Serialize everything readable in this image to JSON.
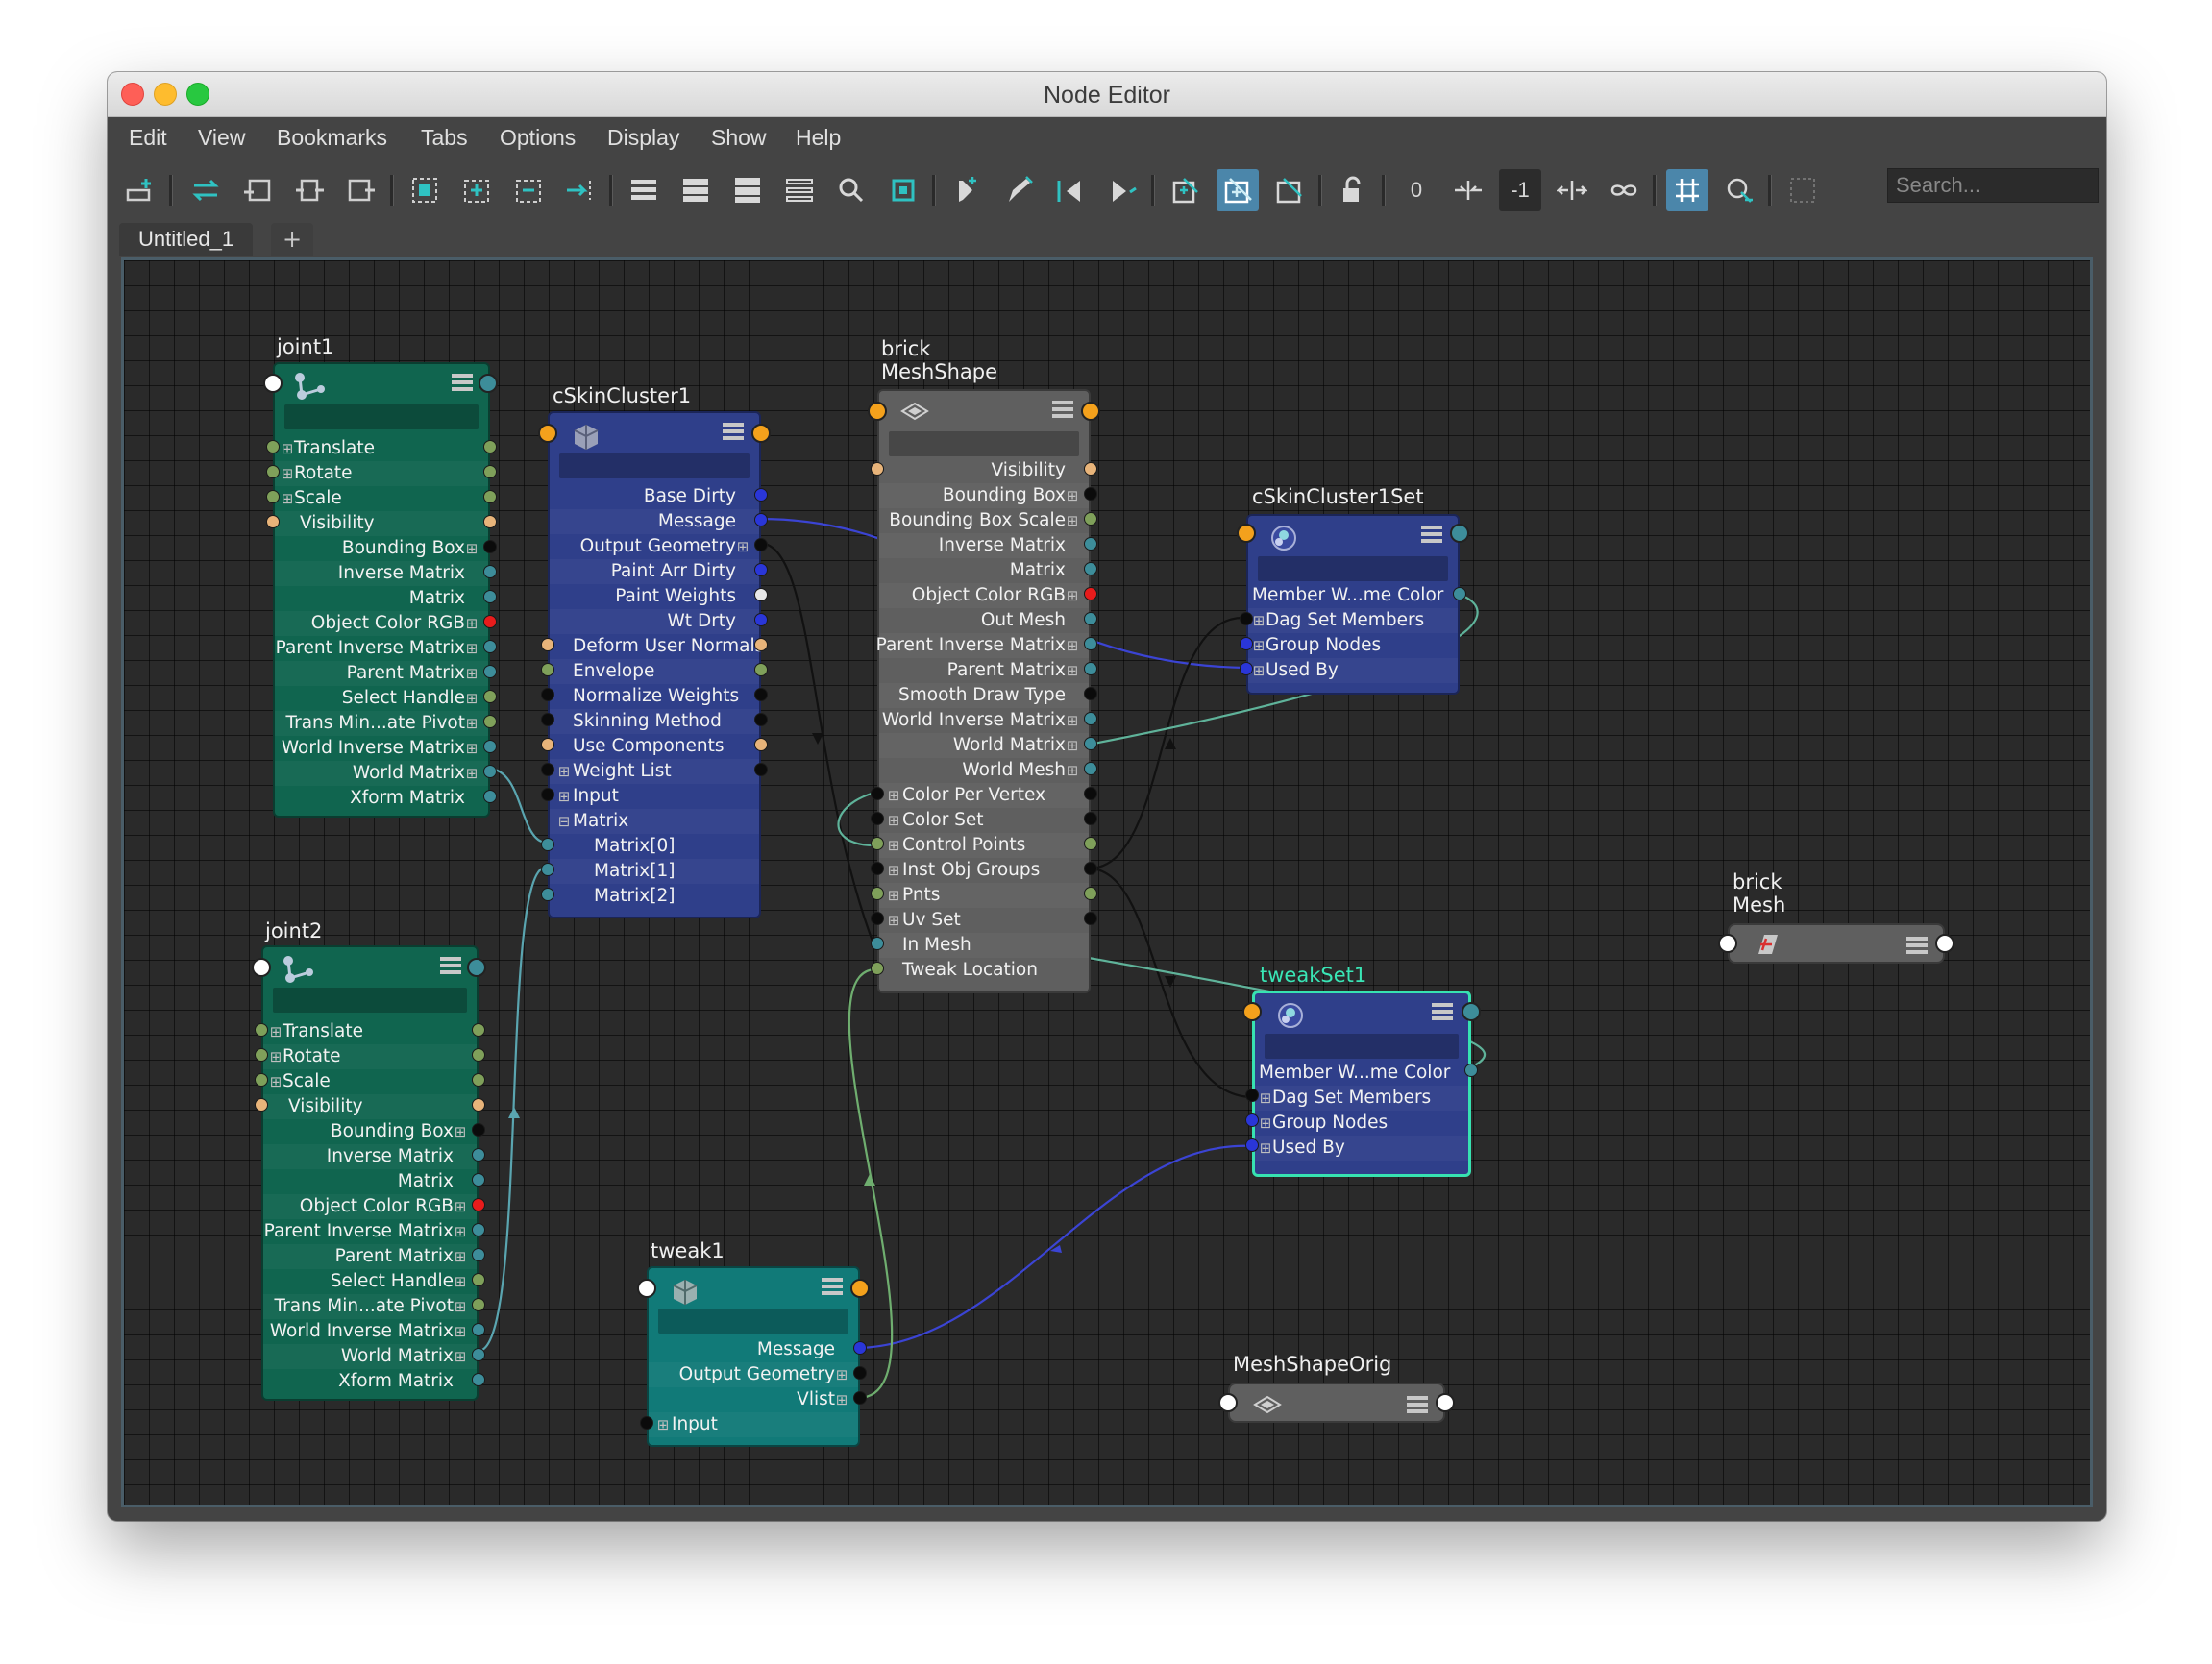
{
  "window": {
    "title": "Node Editor"
  },
  "menu": [
    "Edit",
    "View",
    "Bookmarks",
    "Tabs",
    "Options",
    "Display",
    "Show",
    "Help"
  ],
  "toolbar": {
    "zero_label": "0",
    "minus_one_label": "-1",
    "search_placeholder": "Search..."
  },
  "tabs": {
    "active": "Untitled_1",
    "add": "+"
  },
  "colors": {
    "joint_node": "#10654f",
    "skin_node": "#2f3f8a",
    "shape_node": "#5f5f5f",
    "tweak_node": "#117a78",
    "selected_outline": "#37e2b1"
  },
  "nodes": {
    "joint1": {
      "name": "joint1",
      "attrs": [
        "Translate",
        "Rotate",
        "Scale",
        "Visibility",
        "Bounding Box",
        "Inverse Matrix",
        "Matrix",
        "Object Color RGB",
        "Parent Inverse Matrix",
        "Parent Matrix",
        "Select Handle",
        "Trans Min...ate Pivot",
        "World Inverse Matrix",
        "World Matrix",
        "Xform Matrix"
      ]
    },
    "joint2": {
      "name": "joint2",
      "attrs": [
        "Translate",
        "Rotate",
        "Scale",
        "Visibility",
        "Bounding Box",
        "Inverse Matrix",
        "Matrix",
        "Object Color RGB",
        "Parent Inverse Matrix",
        "Parent Matrix",
        "Select Handle",
        "Trans Min...ate Pivot",
        "World Inverse Matrix",
        "World Matrix",
        "Xform Matrix"
      ]
    },
    "skin": {
      "name": "cSkinCluster1",
      "outputs": [
        "Base Dirty",
        "Message",
        "Output Geometry",
        "Paint Arr Dirty",
        "Paint Weights",
        "Wt Drty"
      ],
      "inputs": [
        "Deform User Normals",
        "Envelope",
        "Normalize Weights",
        "Skinning Method",
        "Use Components",
        "Weight List",
        "Input",
        "Matrix"
      ],
      "matrix_children": [
        "Matrix[0]",
        "Matrix[1]",
        "Matrix[2]"
      ]
    },
    "shape": {
      "name": "brick\nMeshShape",
      "outputs": [
        "Visibility",
        "Bounding Box",
        "Bounding Box Scale",
        "Inverse Matrix",
        "Matrix",
        "Object Color RGB",
        "Out Mesh",
        "Parent Inverse Matrix",
        "Parent Matrix",
        "Smooth Draw Type",
        "World Inverse Matrix",
        "World Matrix",
        "World Mesh"
      ],
      "inputs": [
        "Color Per Vertex",
        "Color Set",
        "Control Points",
        "Inst Obj Groups",
        "Pnts",
        "Uv Set",
        "In Mesh",
        "Tweak Location"
      ]
    },
    "skinset": {
      "name": "cSkinCluster1Set",
      "attrs": [
        "Member W...me Color",
        "Dag Set Members",
        "Group Nodes",
        "Used By"
      ]
    },
    "tweakset": {
      "name": "tweakSet1",
      "attrs": [
        "Member W...me Color",
        "Dag Set Members",
        "Group Nodes",
        "Used By"
      ]
    },
    "tweak": {
      "name": "tweak1",
      "outputs": [
        "Message",
        "Output Geometry",
        "Vlist"
      ],
      "inputs": [
        "Input"
      ]
    },
    "brickmesh": {
      "name": "brick\nMesh"
    },
    "orig": {
      "name": "MeshShapeOrig"
    }
  }
}
